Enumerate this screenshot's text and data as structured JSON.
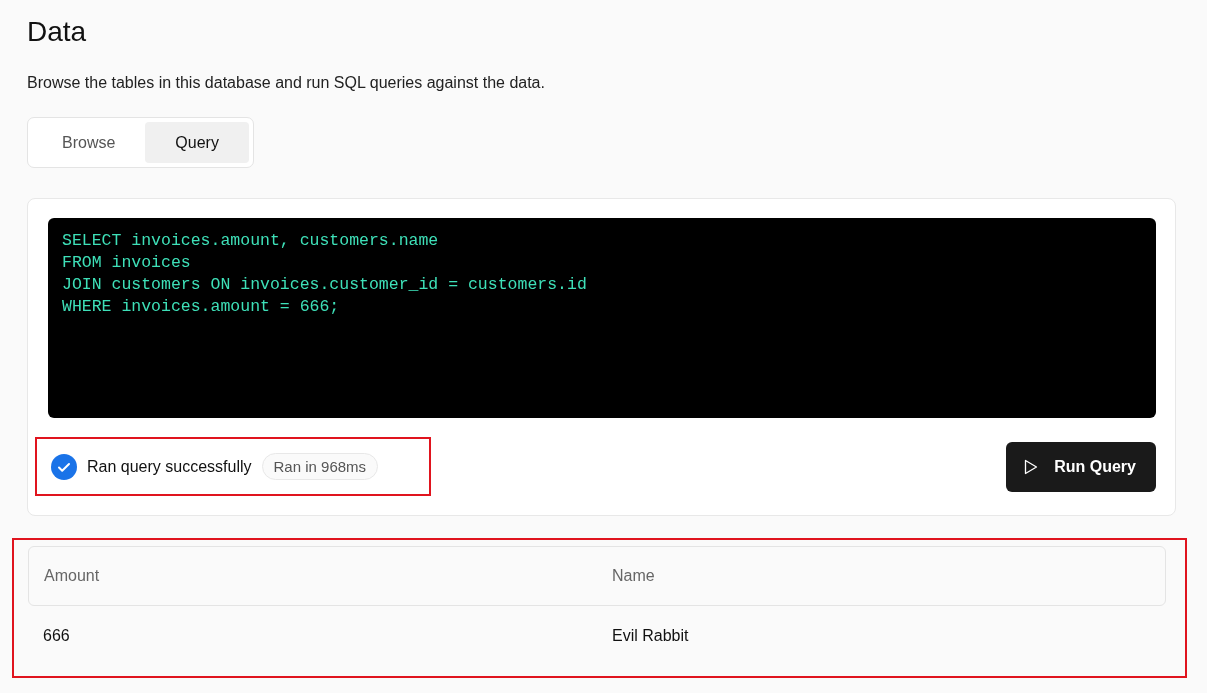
{
  "title": "Data",
  "description": "Browse the tables in this database and run SQL queries against the data.",
  "tabs": [
    {
      "label": "Browse",
      "selected": false
    },
    {
      "label": "Query",
      "selected": true
    }
  ],
  "editor": {
    "lines": [
      "SELECT invoices.amount, customers.name",
      "FROM invoices",
      "JOIN customers ON invoices.customer_id = customers.id",
      "WHERE invoices.amount = 666;"
    ]
  },
  "status": {
    "success": true,
    "message": "Ran query successfully",
    "duration": "Ran in 968ms",
    "highlighted": true
  },
  "run_button": {
    "label": "Run Query"
  },
  "results": {
    "highlighted": true,
    "columns": [
      "Amount",
      "Name"
    ],
    "rows": [
      [
        "666",
        "Evil Rabbit"
      ]
    ]
  }
}
